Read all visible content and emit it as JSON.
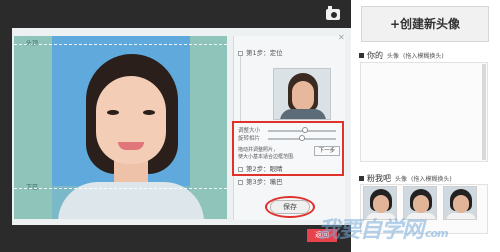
{
  "editor": {
    "guide_top": "头顶",
    "guide_bottom": "下巴",
    "close": "✕",
    "steps": [
      {
        "label": "第1步：定位"
      },
      {
        "label": "第2步：眼睛"
      },
      {
        "label": "第3步：嘴巴"
      }
    ],
    "controls": {
      "size_label": "调整大小",
      "rotate_label": "旋转相片",
      "size_level": 0.55,
      "rotate_level": 0.5,
      "hint_line1": "拖动并调整照片，",
      "hint_line2": "使大小基本适合边框范围.",
      "next_button": "下一步"
    },
    "save_button": "保存",
    "done_button": "返回"
  },
  "sidebar": {
    "create_button": "+创建新头像",
    "yours_title": "你的",
    "yours_sub": "头像",
    "yours_hint": "(拖入模糊换头)",
    "fans_title": "粉我吧",
    "fans_sub": "头像",
    "fans_hint": "(拖入模糊换头)"
  },
  "watermark": {
    "text": "我要自学网",
    "sub": "com"
  },
  "colors": {
    "accent_red": "#e0312b",
    "photo_bg": "#8fc4bb",
    "crop_blue": "#5fa9dc",
    "frame": "#2b2b2b"
  }
}
